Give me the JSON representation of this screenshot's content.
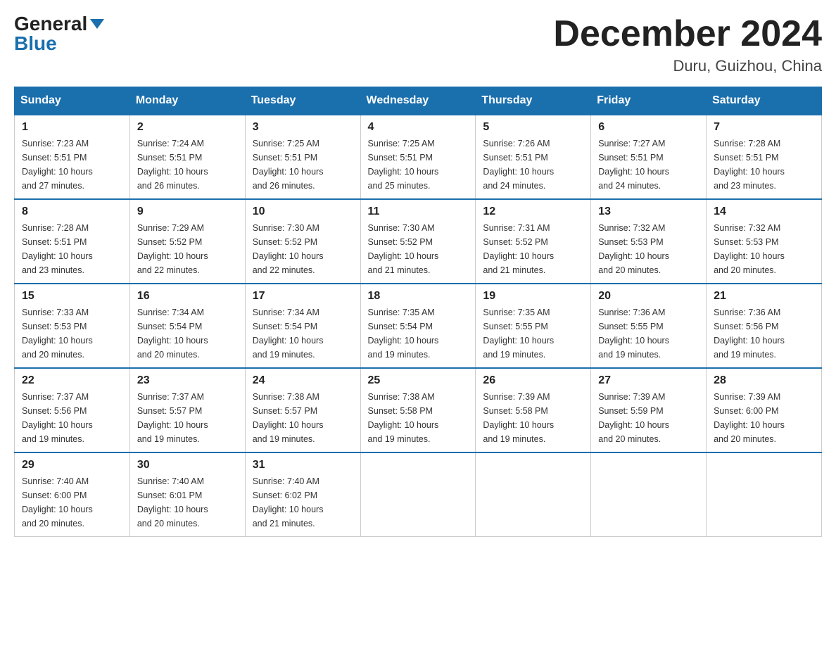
{
  "logo": {
    "general": "General",
    "blue": "Blue"
  },
  "title": "December 2024",
  "subtitle": "Duru, Guizhou, China",
  "headers": [
    "Sunday",
    "Monday",
    "Tuesday",
    "Wednesday",
    "Thursday",
    "Friday",
    "Saturday"
  ],
  "weeks": [
    [
      {
        "day": "1",
        "sunrise": "7:23 AM",
        "sunset": "5:51 PM",
        "daylight": "10 hours and 27 minutes."
      },
      {
        "day": "2",
        "sunrise": "7:24 AM",
        "sunset": "5:51 PM",
        "daylight": "10 hours and 26 minutes."
      },
      {
        "day": "3",
        "sunrise": "7:25 AM",
        "sunset": "5:51 PM",
        "daylight": "10 hours and 26 minutes."
      },
      {
        "day": "4",
        "sunrise": "7:25 AM",
        "sunset": "5:51 PM",
        "daylight": "10 hours and 25 minutes."
      },
      {
        "day": "5",
        "sunrise": "7:26 AM",
        "sunset": "5:51 PM",
        "daylight": "10 hours and 24 minutes."
      },
      {
        "day": "6",
        "sunrise": "7:27 AM",
        "sunset": "5:51 PM",
        "daylight": "10 hours and 24 minutes."
      },
      {
        "day": "7",
        "sunrise": "7:28 AM",
        "sunset": "5:51 PM",
        "daylight": "10 hours and 23 minutes."
      }
    ],
    [
      {
        "day": "8",
        "sunrise": "7:28 AM",
        "sunset": "5:51 PM",
        "daylight": "10 hours and 23 minutes."
      },
      {
        "day": "9",
        "sunrise": "7:29 AM",
        "sunset": "5:52 PM",
        "daylight": "10 hours and 22 minutes."
      },
      {
        "day": "10",
        "sunrise": "7:30 AM",
        "sunset": "5:52 PM",
        "daylight": "10 hours and 22 minutes."
      },
      {
        "day": "11",
        "sunrise": "7:30 AM",
        "sunset": "5:52 PM",
        "daylight": "10 hours and 21 minutes."
      },
      {
        "day": "12",
        "sunrise": "7:31 AM",
        "sunset": "5:52 PM",
        "daylight": "10 hours and 21 minutes."
      },
      {
        "day": "13",
        "sunrise": "7:32 AM",
        "sunset": "5:53 PM",
        "daylight": "10 hours and 20 minutes."
      },
      {
        "day": "14",
        "sunrise": "7:32 AM",
        "sunset": "5:53 PM",
        "daylight": "10 hours and 20 minutes."
      }
    ],
    [
      {
        "day": "15",
        "sunrise": "7:33 AM",
        "sunset": "5:53 PM",
        "daylight": "10 hours and 20 minutes."
      },
      {
        "day": "16",
        "sunrise": "7:34 AM",
        "sunset": "5:54 PM",
        "daylight": "10 hours and 20 minutes."
      },
      {
        "day": "17",
        "sunrise": "7:34 AM",
        "sunset": "5:54 PM",
        "daylight": "10 hours and 19 minutes."
      },
      {
        "day": "18",
        "sunrise": "7:35 AM",
        "sunset": "5:54 PM",
        "daylight": "10 hours and 19 minutes."
      },
      {
        "day": "19",
        "sunrise": "7:35 AM",
        "sunset": "5:55 PM",
        "daylight": "10 hours and 19 minutes."
      },
      {
        "day": "20",
        "sunrise": "7:36 AM",
        "sunset": "5:55 PM",
        "daylight": "10 hours and 19 minutes."
      },
      {
        "day": "21",
        "sunrise": "7:36 AM",
        "sunset": "5:56 PM",
        "daylight": "10 hours and 19 minutes."
      }
    ],
    [
      {
        "day": "22",
        "sunrise": "7:37 AM",
        "sunset": "5:56 PM",
        "daylight": "10 hours and 19 minutes."
      },
      {
        "day": "23",
        "sunrise": "7:37 AM",
        "sunset": "5:57 PM",
        "daylight": "10 hours and 19 minutes."
      },
      {
        "day": "24",
        "sunrise": "7:38 AM",
        "sunset": "5:57 PM",
        "daylight": "10 hours and 19 minutes."
      },
      {
        "day": "25",
        "sunrise": "7:38 AM",
        "sunset": "5:58 PM",
        "daylight": "10 hours and 19 minutes."
      },
      {
        "day": "26",
        "sunrise": "7:39 AM",
        "sunset": "5:58 PM",
        "daylight": "10 hours and 19 minutes."
      },
      {
        "day": "27",
        "sunrise": "7:39 AM",
        "sunset": "5:59 PM",
        "daylight": "10 hours and 20 minutes."
      },
      {
        "day": "28",
        "sunrise": "7:39 AM",
        "sunset": "6:00 PM",
        "daylight": "10 hours and 20 minutes."
      }
    ],
    [
      {
        "day": "29",
        "sunrise": "7:40 AM",
        "sunset": "6:00 PM",
        "daylight": "10 hours and 20 minutes."
      },
      {
        "day": "30",
        "sunrise": "7:40 AM",
        "sunset": "6:01 PM",
        "daylight": "10 hours and 20 minutes."
      },
      {
        "day": "31",
        "sunrise": "7:40 AM",
        "sunset": "6:02 PM",
        "daylight": "10 hours and 21 minutes."
      },
      null,
      null,
      null,
      null
    ]
  ],
  "labels": {
    "sunrise": "Sunrise:",
    "sunset": "Sunset:",
    "daylight": "Daylight:"
  }
}
